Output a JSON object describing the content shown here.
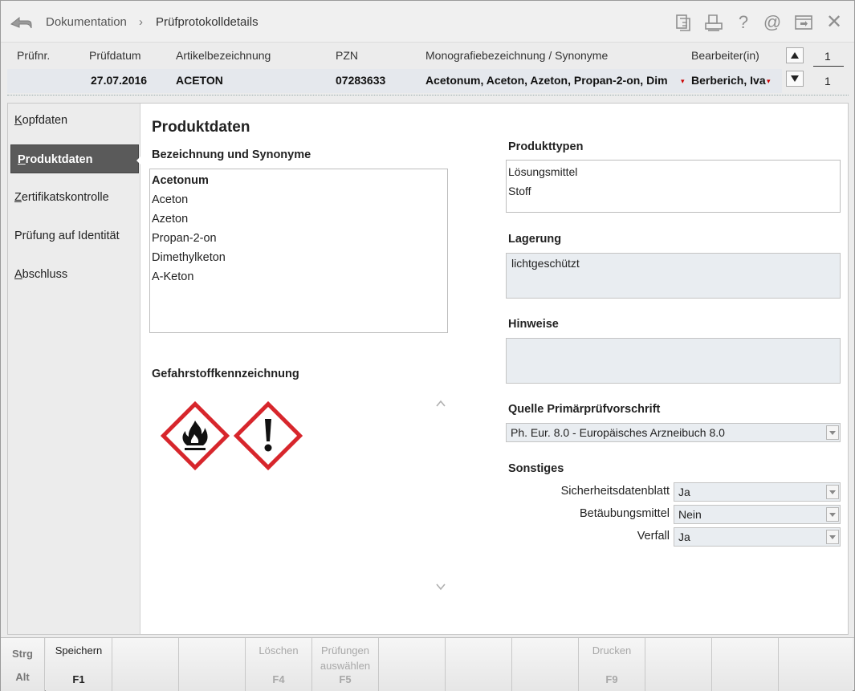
{
  "titlebar": {
    "breadcrumb_root": "Dokumentation",
    "breadcrumb_sep": "›",
    "breadcrumb_current": "Prüfprotokolldetails",
    "icons": [
      "copy-icon",
      "print-preview-icon",
      "help-icon",
      "email-icon",
      "settings-window-icon",
      "close-icon"
    ],
    "help_glyph": "?",
    "at_glyph": "@",
    "close_glyph": "✕"
  },
  "header": {
    "columns": {
      "pruefnr": "Prüfnr.",
      "pruefdatum": "Prüfdatum",
      "artikel": "Artikelbezeichnung",
      "pzn": "PZN",
      "monografie": "Monografiebezeichnung / Synonyme",
      "bearbeiter": "Bearbeiter(in)"
    },
    "row": {
      "pruefnr": "",
      "pruefdatum": "27.07.2016",
      "artikel": "ACETON",
      "pzn": "07283633",
      "monografie": "Acetonum, Aceton, Azeton, Propan-2-on, Dim",
      "bearbeiter": "Berberich, Iva"
    },
    "counter_top": "1",
    "counter_bottom": "1"
  },
  "sidebar": {
    "items": [
      {
        "label_ul": "K",
        "label_rest": "opfdaten"
      },
      {
        "label_ul": "P",
        "label_rest": "roduktdaten"
      },
      {
        "label_ul": "Z",
        "label_rest": "ertifikatskontrolle"
      },
      {
        "label_ul": "",
        "label_rest": "Prüfung auf Identität"
      },
      {
        "label_ul": "A",
        "label_rest": "bschluss"
      }
    ]
  },
  "main": {
    "title": "Produktdaten",
    "synonyms_heading": "Bezeichnung und Synonyme",
    "synonyms": [
      "Acetonum",
      "Aceton",
      "Azeton",
      "Propan-2-on",
      "Dimethylketon",
      "A-Keton"
    ],
    "hazard_heading": "Gefahrstoffkennzeichnung",
    "hazard_pictograms": [
      "flame-pictogram",
      "exclamation-pictogram"
    ],
    "product_types_heading": "Produkttypen",
    "product_types": [
      "Lösungsmittel",
      "Stoff"
    ],
    "storage_heading": "Lagerung",
    "storage_value": "lichtgeschützt",
    "notes_heading": "Hinweise",
    "notes_value": "",
    "source_heading": "Quelle Primärprüfvorschrift",
    "source_value": "Ph. Eur. 8.0 - Europäisches Arzneibuch 8.0",
    "misc_heading": "Sonstiges",
    "misc": {
      "sdb_label": "Sicherheitsdatenblatt",
      "sdb_value": "Ja",
      "btm_label": "Betäubungsmittel",
      "btm_value": "Nein",
      "verfall_label": "Verfall",
      "verfall_value": "Ja"
    }
  },
  "fkeys": {
    "strg": "Strg",
    "alt": "Alt",
    "f1_label": "Speichern",
    "f1_key": "F1",
    "f4_label": "Löschen",
    "f4_key": "F4",
    "f5_label_1": "Prüfungen",
    "f5_label_2": "auswählen",
    "f5_key": "F5",
    "f9_label": "Drucken",
    "f9_key": "F9"
  },
  "colors": {
    "active_nav_bg": "#5a5a5a",
    "header_row_bg": "#e5e8ed",
    "readonly_bg": "#e9edf1",
    "hazard_red": "#d7262c"
  }
}
